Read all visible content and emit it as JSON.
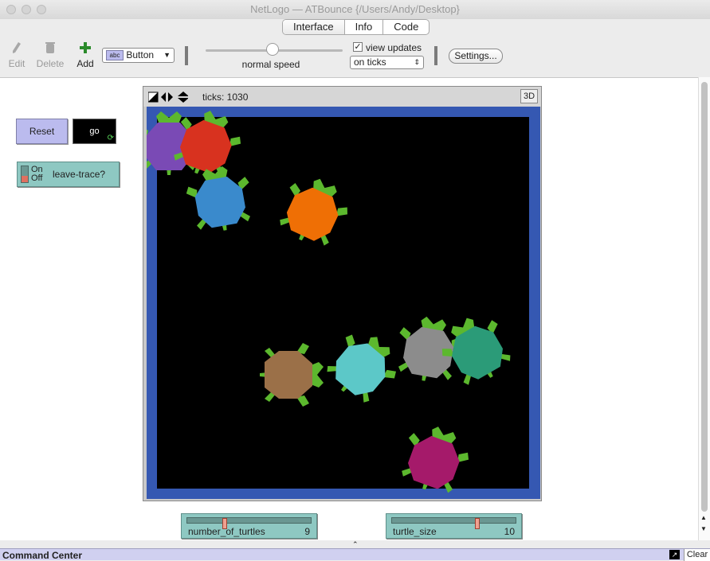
{
  "window": {
    "title": "NetLogo — ATBounce {/Users/Andy/Desktop}"
  },
  "tabs": [
    {
      "label": "Interface"
    },
    {
      "label": "Info"
    },
    {
      "label": "Code"
    }
  ],
  "toolbar": {
    "edit_label": "Edit",
    "delete_label": "Delete",
    "add_label": "Add",
    "widget_type_selected": "Button",
    "speed_label": "normal speed",
    "speed_level": 0.5,
    "view_updates_label": "view updates",
    "view_updates_checked": true,
    "update_mode_selected": "on ticks",
    "settings_label": "Settings..."
  },
  "widgets": {
    "reset_button_label": "Reset",
    "go_button_label": "go",
    "switch_on": "On",
    "switch_off": "Off",
    "switch_label": "leave-trace?",
    "switch_state": "off"
  },
  "view": {
    "ticks_text": "ticks: 1030",
    "btn_3d": "3D",
    "world_color": "#000000",
    "border_color": "#3558b2",
    "turtle_head_color": "#5cb82e",
    "turtles": [
      {
        "color": "#7a4ab5"
      },
      {
        "color": "#d8321f"
      },
      {
        "color": "#3a8acc"
      },
      {
        "color": "#ef6f05"
      },
      {
        "color": "#9b7048"
      },
      {
        "color": "#5cc8c8"
      },
      {
        "color": "#8c8c8c"
      },
      {
        "color": "#2b9b78"
      },
      {
        "color": "#a51a6a"
      }
    ]
  },
  "sliders": [
    {
      "name": "number_of_turtles",
      "value": "9",
      "fraction": 0.3
    },
    {
      "name": "turtle_size",
      "value": "10",
      "fraction": 0.7
    }
  ],
  "command_center": {
    "label": "Command Center",
    "clear_label": "Clear"
  }
}
